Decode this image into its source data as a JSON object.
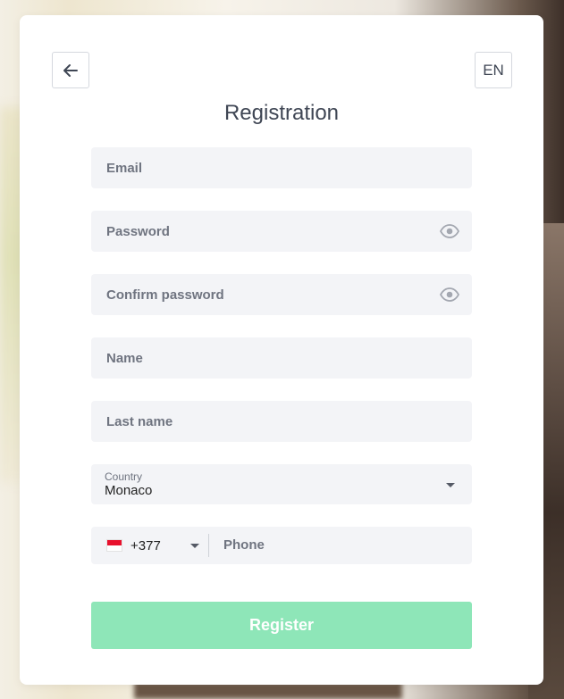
{
  "header": {
    "title": "Registration",
    "language": "EN"
  },
  "form": {
    "email_placeholder": "Email",
    "password_placeholder": "Password",
    "confirm_password_placeholder": "Confirm password",
    "name_placeholder": "Name",
    "last_name_placeholder": "Last name",
    "country_label": "Country",
    "country_value": "Monaco",
    "phone_code": "+377",
    "phone_placeholder": "Phone",
    "submit_label": "Register"
  },
  "icons": {
    "back": "arrow-left-icon",
    "password_toggle": "eye-icon",
    "dropdown": "caret-down-icon",
    "flag": "monaco-flag-icon"
  },
  "colors": {
    "accent": "#8ee6b8",
    "field_bg": "#f3f4f7",
    "text": "#3f4654",
    "flag_red": "#e8112d"
  }
}
